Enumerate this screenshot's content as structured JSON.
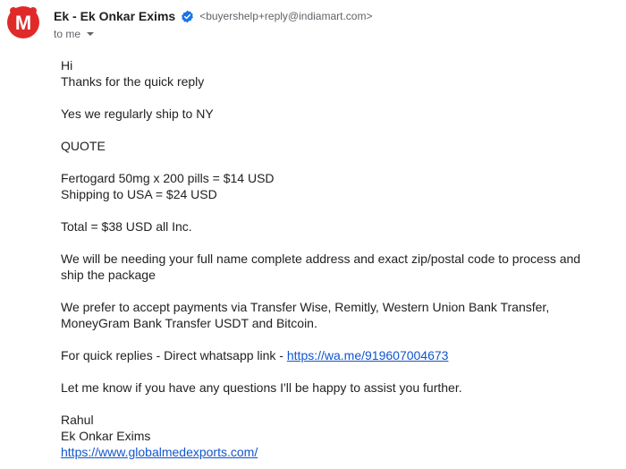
{
  "sender": {
    "avatar_letter": "M",
    "avatar_color": "#e02a2a",
    "name": "Ek - Ek Onkar Exims",
    "email": "<buyershelp+reply@indiamart.com>",
    "verified_icon": "verified-badge-icon",
    "verified_color": "#1a73e8"
  },
  "recipient": {
    "label": "to me",
    "caret_icon": "caret-down-icon"
  },
  "body": {
    "greeting": "Hi",
    "thanks": "Thanks for the quick reply",
    "ship": "Yes we regularly ship to NY",
    "quote_heading": "QUOTE",
    "item_line": "Fertogard 50mg x 200 pills = $14 USD",
    "shipping_line": "Shipping to USA = $24 USD",
    "total_line": "Total = $38 USD all Inc.",
    "address_request": "We will be needing your full name complete address and exact zip/postal code to process and ship the package",
    "payment": "We prefer to accept payments via Transfer Wise, Remitly, Western Union Bank Transfer, MoneyGram Bank Transfer USDT and Bitcoin.",
    "whatsapp_prefix": "For quick replies - Direct whatsapp link - ",
    "whatsapp_link": "https://wa.me/919607004673",
    "closing": "Let me know if you have any questions I'll be happy to assist you further.",
    "signature_name": "Rahul",
    "signature_company": "Ek Onkar Exims",
    "signature_link": "https://www.globalmedexports.com/"
  }
}
